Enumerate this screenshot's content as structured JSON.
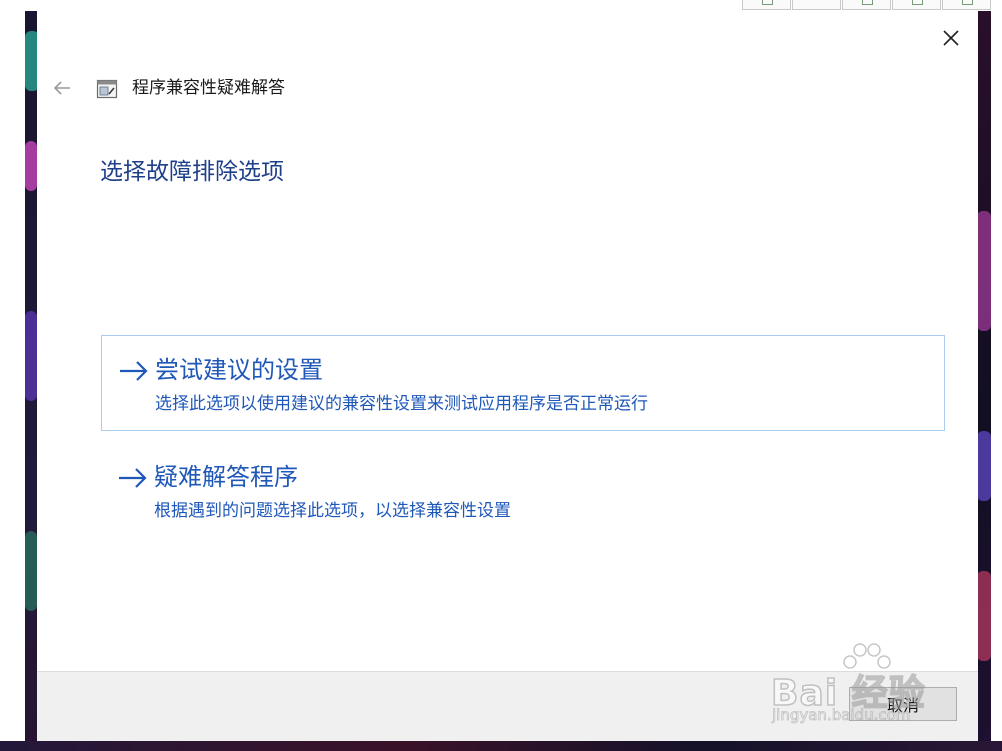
{
  "dialog": {
    "title": "程序兼容性疑难解答",
    "heading": "选择故障排除选项",
    "close_icon": "close-icon",
    "back_icon": "back-arrow-icon",
    "app_icon": "compatibility-troubleshooter-icon"
  },
  "options": [
    {
      "title": "尝试建议的设置",
      "description": "选择此选项以使用建议的兼容性设置来测试应用程序是否正常运行",
      "icon": "arrow-right-icon",
      "selected": true
    },
    {
      "title": "疑难解答程序",
      "description": "根据遇到的问题选择此选项，以选择兼容性设置",
      "icon": "arrow-right-icon",
      "selected": false
    }
  ],
  "footer": {
    "cancel_label": "取消"
  },
  "watermark": {
    "brand": "Bai  经验",
    "url": "jingyan.baidu.com"
  },
  "colors": {
    "accent": "#1f58b8",
    "heading": "#1e3f8a",
    "selection_border": "#a9cdee",
    "footer_bg": "#f0f0f0"
  }
}
